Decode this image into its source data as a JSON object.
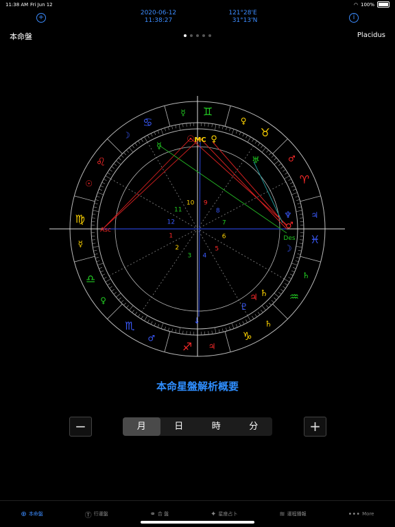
{
  "status": {
    "time": "11:38 AM",
    "date": "Fri Jun 12",
    "battery": "100%"
  },
  "header": {
    "date": "2020-06-12",
    "clock": "11:38:27",
    "longitude": "121°28'E",
    "latitude": "31°13'N",
    "add_icon": "+",
    "info_icon": "i"
  },
  "page": {
    "title": "本命盤",
    "house_system": "Placidus"
  },
  "wheel": {
    "signs": [
      {
        "glyph": "♋",
        "color": "#3b5bff"
      },
      {
        "glyph": "♌",
        "color": "#ff2a2a"
      },
      {
        "glyph": "♍",
        "color": "#ffd400"
      },
      {
        "glyph": "♎",
        "color": "#22cc22"
      },
      {
        "glyph": "♏",
        "color": "#3b5bff"
      },
      {
        "glyph": "♐",
        "color": "#ff2a2a"
      },
      {
        "glyph": "♑",
        "color": "#ffd400"
      },
      {
        "glyph": "♒",
        "color": "#22cc22"
      },
      {
        "glyph": "♓",
        "color": "#3b5bff"
      },
      {
        "glyph": "♈",
        "color": "#ff2a2a"
      },
      {
        "glyph": "♉",
        "color": "#ffd400"
      },
      {
        "glyph": "♊",
        "color": "#22cc22"
      }
    ],
    "rulers": [
      "☽",
      "☉",
      "☿",
      "♀",
      "♂",
      "♃",
      "♄",
      "♄",
      "♃",
      "♂",
      "♀",
      "☿"
    ],
    "houses": [
      "1",
      "2",
      "3",
      "4",
      "5",
      "6",
      "7",
      "8",
      "9",
      "10",
      "11",
      "12"
    ],
    "asc_label": "Asc",
    "des_label": "Des",
    "mc_label": "MC"
  },
  "analysis_label": "本命星盤解析概要",
  "stepper": {
    "minus": "−",
    "plus": "+",
    "segments": [
      "月",
      "日",
      "時",
      "分"
    ],
    "selected": 0
  },
  "tabs": [
    {
      "icon": "⊕",
      "label": "本命盤"
    },
    {
      "icon": "Ⓣ",
      "label": "行運盤"
    },
    {
      "icon": "⚭",
      "label": "合 盤"
    },
    {
      "icon": "✦",
      "label": "星座占卜"
    },
    {
      "icon": "≋",
      "label": "運程播報"
    },
    {
      "icon": "•••",
      "label": "More"
    }
  ]
}
